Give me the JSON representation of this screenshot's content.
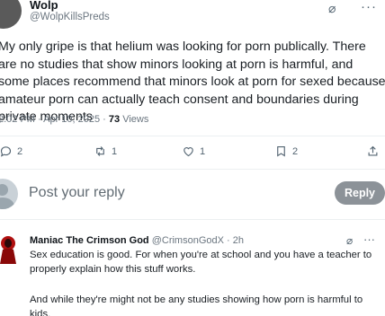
{
  "post": {
    "author_name": "Wolp",
    "author_handle": "@WolpKillsPreds",
    "text": "My only gripe is that helium was looking for porn publically. There are no studies that show minors looking at porn is harmful, and some places recommend that minors look at porn for sexed because amateur porn can actually teach consent and boundaries during private moments",
    "timestamp": "2:02 PM · Apr 10, 2025 · ",
    "views_count": "73",
    "views_label": " Views"
  },
  "actions": {
    "replies": "2",
    "reposts": "1",
    "likes": "1",
    "bookmarks": "2"
  },
  "reply_bar": {
    "placeholder": "Post your reply",
    "button_label": "Reply"
  },
  "comment": {
    "author_name": "Maniac The Crimson God",
    "author_handle": "@CrimsonGodX · 2h",
    "text1": "Sex education is good. For when you're at school and you have a teacher to properly explain how this stuff works.",
    "text2": "And while they're might not be any studies showing how porn is harmful to kids."
  },
  "icons": [
    "grok-icon",
    "more-icon",
    "reply-icon",
    "repost-icon",
    "like-icon",
    "bookmark-icon",
    "share-icon",
    "user-avatar-icon"
  ],
  "colors": {
    "text_primary": "#0f1419",
    "text_secondary": "#6b7680",
    "reply_button_bg": "#8c9298",
    "divider": "#eceff1"
  }
}
